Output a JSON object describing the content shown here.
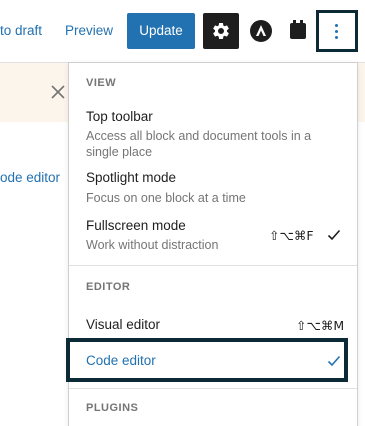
{
  "header": {
    "switch_draft_label": "to draft",
    "preview_label": "Preview",
    "update_label": "Update",
    "settings_icon": "gear-icon",
    "astra_icon": "astra-logo-icon",
    "block_icon": "block-plugin-icon",
    "options_icon": "vertical-dots-icon"
  },
  "background": {
    "notice_close_icon": "close-icon",
    "code_editor_tab_label": "ode editor"
  },
  "menu": {
    "view_label": "VIEW",
    "top_toolbar": {
      "title": "Top toolbar",
      "description": "Access all block and document tools in a single place"
    },
    "spotlight": {
      "title": "Spotlight mode",
      "description": "Focus on one block at a time"
    },
    "fullscreen": {
      "title": "Fullscreen mode",
      "description": "Work without distraction",
      "shortcut": "⇧⌥⌘F",
      "checked": true
    },
    "editor_label": "EDITOR",
    "visual_editor": {
      "title": "Visual editor",
      "shortcut": "⇧⌥⌘M"
    },
    "code_editor": {
      "title": "Code editor",
      "checked": true
    },
    "plugins_label": "PLUGINS"
  },
  "colors": {
    "accent": "#2271b1",
    "highlight_border": "#0c2a35",
    "notice_bg": "#fcf5ec"
  }
}
